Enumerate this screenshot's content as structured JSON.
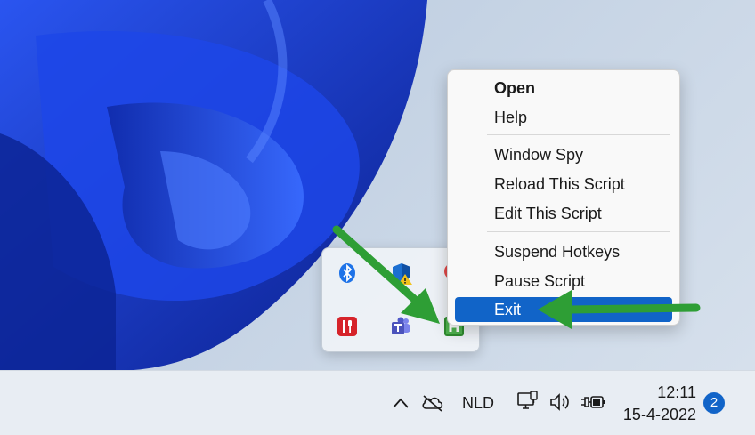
{
  "context_menu": {
    "items": [
      {
        "label": "Open"
      },
      {
        "label": "Help"
      },
      {
        "label": "Window Spy"
      },
      {
        "label": "Reload This Script"
      },
      {
        "label": "Edit This Script"
      },
      {
        "label": "Suspend Hotkeys"
      },
      {
        "label": "Pause Script"
      },
      {
        "label": "Exit"
      }
    ],
    "highlighted": "Exit"
  },
  "tray_flyout": {
    "icons": [
      "bluetooth-icon",
      "defender-warning-icon",
      "red-alert-icon",
      "food-app-icon",
      "teams-icon",
      "autohotkey-icon"
    ]
  },
  "taskbar": {
    "language": "NLD",
    "time": "12:11",
    "date": "15-4-2022",
    "notification_count": "2"
  },
  "colors": {
    "highlight": "#1164c8",
    "arrow": "#2e9e35",
    "wallpaper_blue": "#1a3fd4"
  }
}
